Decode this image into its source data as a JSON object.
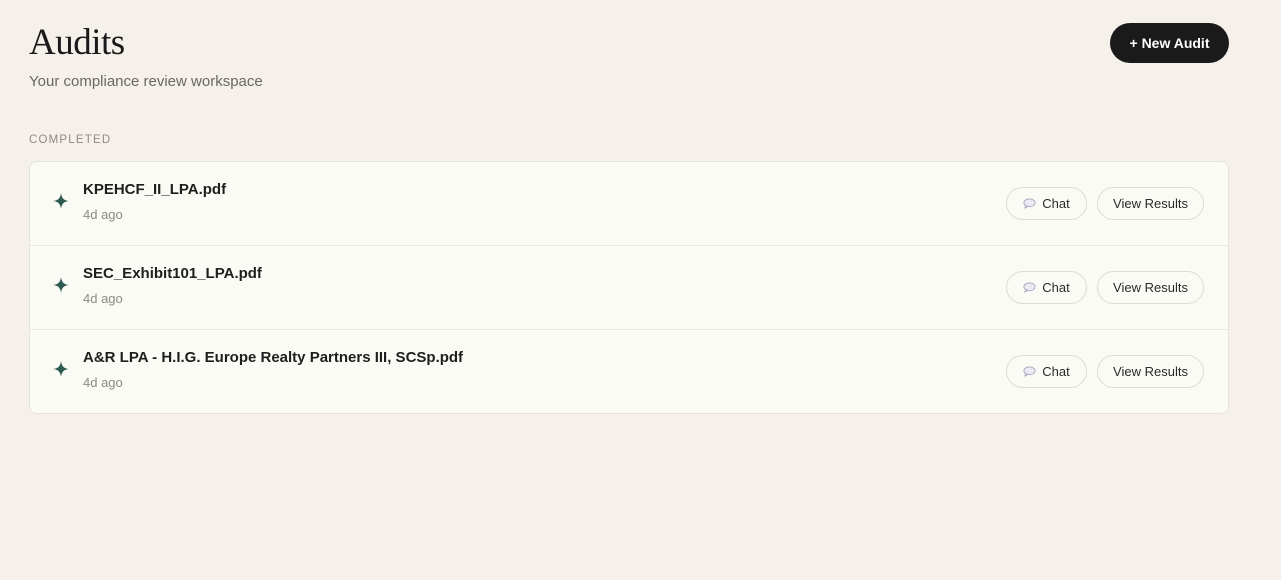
{
  "header": {
    "title": "Audits",
    "subtitle": "Your compliance review workspace",
    "new_audit_label": "+ New Audit"
  },
  "section": {
    "label": "COMPLETED"
  },
  "audits": [
    {
      "file_name": "KPEHCF_II_LPA.pdf",
      "time": "4d ago",
      "chat_label": "Chat",
      "view_label": "View Results"
    },
    {
      "file_name": "SEC_Exhibit101_LPA.pdf",
      "time": "4d ago",
      "chat_label": "Chat",
      "view_label": "View Results"
    },
    {
      "file_name": "A&R LPA - H.I.G. Europe Realty Partners III, SCSp.pdf",
      "time": "4d ago",
      "chat_label": "Chat",
      "view_label": "View Results"
    }
  ],
  "icons": {
    "status": "sparkle-icon",
    "chat": "chat-bubble-icon"
  },
  "colors": {
    "background": "#f5f0ea",
    "card": "#fbfbf6",
    "primary_button": "#1a1a1a",
    "sparkle": "#2f5a52"
  }
}
